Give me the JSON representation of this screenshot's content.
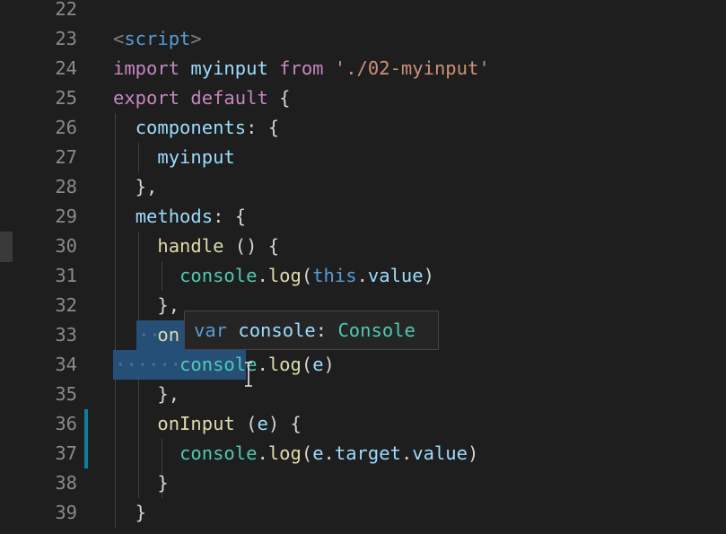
{
  "editor": {
    "lines": [
      {
        "num": "22",
        "tokens": []
      },
      {
        "num": "23",
        "tokens": [
          {
            "t": "<",
            "c": "tag"
          },
          {
            "t": "script",
            "c": "tagname"
          },
          {
            "t": ">",
            "c": "tag"
          }
        ]
      },
      {
        "num": "24",
        "tokens": [
          {
            "t": "import",
            "c": "kw"
          },
          {
            "t": " "
          },
          {
            "t": "myinput",
            "c": "var"
          },
          {
            "t": " "
          },
          {
            "t": "from",
            "c": "kw"
          },
          {
            "t": " "
          },
          {
            "t": "'./02-myinput'",
            "c": "str"
          }
        ]
      },
      {
        "num": "25",
        "tokens": [
          {
            "t": "export",
            "c": "kw"
          },
          {
            "t": " "
          },
          {
            "t": "default",
            "c": "kw"
          },
          {
            "t": " {"
          }
        ]
      },
      {
        "num": "26",
        "tokens": [
          {
            "t": "  "
          },
          {
            "t": "components",
            "c": "prop"
          },
          {
            "t": ": {"
          }
        ]
      },
      {
        "num": "27",
        "tokens": [
          {
            "t": "    "
          },
          {
            "t": "myinput",
            "c": "prop"
          }
        ]
      },
      {
        "num": "28",
        "tokens": [
          {
            "t": "  },"
          }
        ]
      },
      {
        "num": "29",
        "tokens": [
          {
            "t": "  "
          },
          {
            "t": "methods",
            "c": "prop"
          },
          {
            "t": ": {"
          }
        ]
      },
      {
        "num": "30",
        "tokens": [
          {
            "t": "    "
          },
          {
            "t": "handle",
            "c": "fn"
          },
          {
            "t": " () {"
          }
        ]
      },
      {
        "num": "31",
        "tokens": [
          {
            "t": "      "
          },
          {
            "t": "console",
            "c": "type"
          },
          {
            "t": "."
          },
          {
            "t": "log",
            "c": "fn"
          },
          {
            "t": "("
          },
          {
            "t": "this",
            "c": "this"
          },
          {
            "t": "."
          },
          {
            "t": "value",
            "c": "prop"
          },
          {
            "t": ")"
          }
        ]
      },
      {
        "num": "32",
        "tokens": [
          {
            "t": "    },"
          }
        ]
      },
      {
        "num": "33",
        "tokens": [
          {
            "t": "    "
          },
          {
            "t": "on",
            "c": "fn"
          }
        ]
      },
      {
        "num": "34",
        "tokens": [
          {
            "t": "      "
          },
          {
            "t": "console",
            "c": "type"
          },
          {
            "t": "."
          },
          {
            "t": "log",
            "c": "fn"
          },
          {
            "t": "("
          },
          {
            "t": "e",
            "c": "var"
          },
          {
            "t": ")"
          }
        ]
      },
      {
        "num": "35",
        "tokens": [
          {
            "t": "    },"
          }
        ]
      },
      {
        "num": "36",
        "tokens": [
          {
            "t": "    "
          },
          {
            "t": "onInput",
            "c": "fn"
          },
          {
            "t": " ("
          },
          {
            "t": "e",
            "c": "var"
          },
          {
            "t": ") {"
          }
        ]
      },
      {
        "num": "37",
        "tokens": [
          {
            "t": "      "
          },
          {
            "t": "console",
            "c": "type"
          },
          {
            "t": "."
          },
          {
            "t": "log",
            "c": "fn"
          },
          {
            "t": "("
          },
          {
            "t": "e",
            "c": "var"
          },
          {
            "t": "."
          },
          {
            "t": "target",
            "c": "prop"
          },
          {
            "t": "."
          },
          {
            "t": "value",
            "c": "prop"
          },
          {
            "t": ")"
          }
        ]
      },
      {
        "num": "38",
        "tokens": [
          {
            "t": "    }"
          }
        ]
      },
      {
        "num": "39",
        "tokens": [
          {
            "t": "  }"
          }
        ]
      }
    ]
  },
  "hover": {
    "keyword": "var",
    "name": "console",
    "separator": ":",
    "type": "Console"
  },
  "colors": {
    "background": "#1e1e1e",
    "selection": "#264f78",
    "modified_marker": "#0c7d9d"
  }
}
